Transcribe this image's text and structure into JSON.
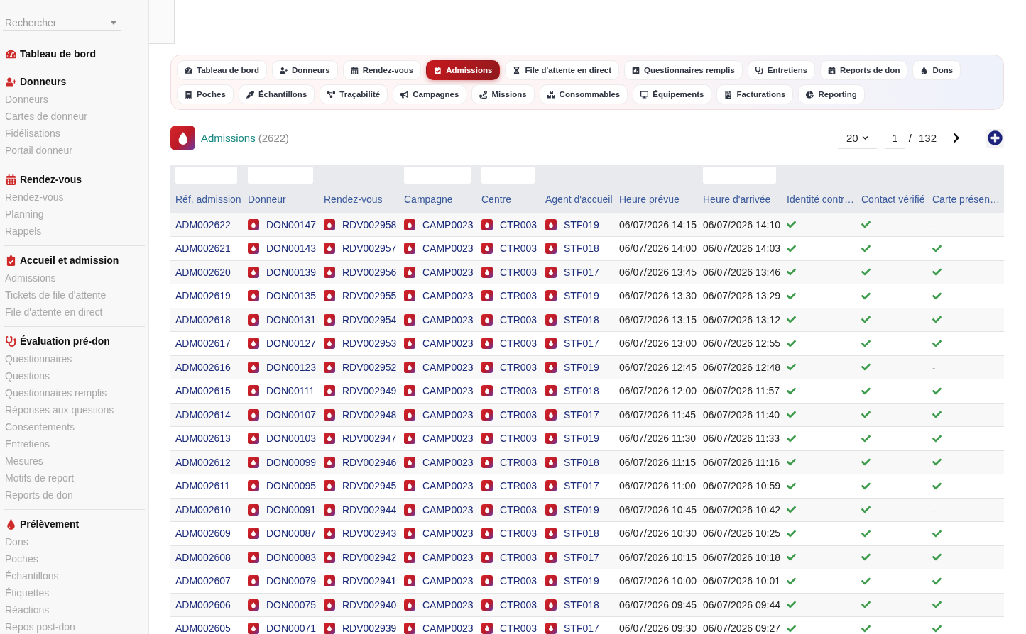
{
  "sidebar": {
    "search": {
      "placeholder": "Rechercher"
    },
    "sections": [
      {
        "title": "Tableau de bord"
      },
      {
        "title": "Donneurs",
        "items": [
          "Donneurs",
          "Cartes de donneur",
          "Fidélisations",
          "Portail donneur"
        ]
      },
      {
        "title": "Rendez-vous",
        "items": [
          "Rendez-vous",
          "Planning",
          "Rappels"
        ]
      },
      {
        "title": "Accueil et admission",
        "items": [
          "Admissions",
          "Tickets de file d'attente",
          "File d'attente en direct"
        ]
      },
      {
        "title": "Évaluation pré-don",
        "items": [
          "Questionnaires",
          "Questions",
          "Questionnaires remplis",
          "Réponses aux questions",
          "Consentements",
          "Entretiens",
          "Mesures",
          "Motifs de report",
          "Reports de don"
        ]
      },
      {
        "title": "Prélèvement",
        "items": [
          "Dons",
          "Poches",
          "Échantillons",
          "Étiquettes",
          "Réactions",
          "Repos post-don"
        ]
      }
    ]
  },
  "nav_tab_rows": [
    [
      {
        "label": "Tableau de bord",
        "selected": false
      },
      {
        "label": "Donneurs",
        "selected": false
      },
      {
        "label": "Rendez-vous",
        "selected": false
      },
      {
        "label": "Admissions",
        "selected": true
      },
      {
        "label": "File d'attente en direct",
        "selected": false
      },
      {
        "label": "Questionnaires remplis",
        "selected": false
      },
      {
        "label": "Entretiens",
        "selected": false
      },
      {
        "label": "Reports de don",
        "selected": false
      },
      {
        "label": "Dons",
        "selected": false
      }
    ],
    [
      {
        "label": "Poches",
        "selected": false
      },
      {
        "label": "Échantillons",
        "selected": false
      },
      {
        "label": "Traçabilité",
        "selected": false
      },
      {
        "label": "Campagnes",
        "selected": false
      },
      {
        "label": "Missions",
        "selected": false
      },
      {
        "label": "Consommables",
        "selected": false
      },
      {
        "label": "Équipements",
        "selected": false
      },
      {
        "label": "Facturations",
        "selected": false
      },
      {
        "label": "Reporting",
        "selected": false
      }
    ]
  ],
  "list_header": {
    "title": "Admissions",
    "count": "(2622)",
    "page_size": "20",
    "page": "1",
    "page_separator": "/",
    "page_count": "132"
  },
  "table": {
    "columns": [
      {
        "label": "Réf. admission",
        "filter": true
      },
      {
        "label": "Donneur",
        "filter": true
      },
      {
        "label": "Rendez-vous",
        "filter": false
      },
      {
        "label": "Campagne",
        "filter": true
      },
      {
        "label": "Centre",
        "filter": true
      },
      {
        "label": "Agent d'accueil",
        "filter": false
      },
      {
        "label": "Heure prévue",
        "filter": false
      },
      {
        "label": "Heure d'arrivée",
        "filter": true
      },
      {
        "label": "Identité contr…",
        "filter": false
      },
      {
        "label": "Contact vérifié",
        "filter": false
      },
      {
        "label": "Carte présen…",
        "filter": false
      }
    ],
    "rows": [
      {
        "ref": "ADM002622",
        "donor": "DON00147",
        "appointment": "RDV002958",
        "campaign": "CAMP0023",
        "center": "CTR003",
        "agent": "STF019",
        "scheduled_time": "06/07/2026 14:15",
        "arrival_time": "06/07/2026 14:10",
        "identity_checked": true,
        "contact_verified": true,
        "card_presented": false,
        "card_presented_text": "-"
      },
      {
        "ref": "ADM002621",
        "donor": "DON00143",
        "appointment": "RDV002957",
        "campaign": "CAMP0023",
        "center": "CTR003",
        "agent": "STF018",
        "scheduled_time": "06/07/2026 14:00",
        "arrival_time": "06/07/2026 14:03",
        "identity_checked": true,
        "contact_verified": true,
        "card_presented": true
      },
      {
        "ref": "ADM002620",
        "donor": "DON00139",
        "appointment": "RDV002956",
        "campaign": "CAMP0023",
        "center": "CTR003",
        "agent": "STF017",
        "scheduled_time": "06/07/2026 13:45",
        "arrival_time": "06/07/2026 13:46",
        "identity_checked": true,
        "contact_verified": true,
        "card_presented": true
      },
      {
        "ref": "ADM002619",
        "donor": "DON00135",
        "appointment": "RDV002955",
        "campaign": "CAMP0023",
        "center": "CTR003",
        "agent": "STF019",
        "scheduled_time": "06/07/2026 13:30",
        "arrival_time": "06/07/2026 13:29",
        "identity_checked": true,
        "contact_verified": true,
        "card_presented": true
      },
      {
        "ref": "ADM002618",
        "donor": "DON00131",
        "appointment": "RDV002954",
        "campaign": "CAMP0023",
        "center": "CTR003",
        "agent": "STF018",
        "scheduled_time": "06/07/2026 13:15",
        "arrival_time": "06/07/2026 13:12",
        "identity_checked": true,
        "contact_verified": true,
        "card_presented": true
      },
      {
        "ref": "ADM002617",
        "donor": "DON00127",
        "appointment": "RDV002953",
        "campaign": "CAMP0023",
        "center": "CTR003",
        "agent": "STF017",
        "scheduled_time": "06/07/2026 13:00",
        "arrival_time": "06/07/2026 12:55",
        "identity_checked": true,
        "contact_verified": true,
        "card_presented": true
      },
      {
        "ref": "ADM002616",
        "donor": "DON00123",
        "appointment": "RDV002952",
        "campaign": "CAMP0023",
        "center": "CTR003",
        "agent": "STF019",
        "scheduled_time": "06/07/2026 12:45",
        "arrival_time": "06/07/2026 12:48",
        "identity_checked": true,
        "contact_verified": true,
        "card_presented": false,
        "card_presented_text": "-"
      },
      {
        "ref": "ADM002615",
        "donor": "DON00111",
        "appointment": "RDV002949",
        "campaign": "CAMP0023",
        "center": "CTR003",
        "agent": "STF018",
        "scheduled_time": "06/07/2026 12:00",
        "arrival_time": "06/07/2026 11:57",
        "identity_checked": true,
        "contact_verified": true,
        "card_presented": true
      },
      {
        "ref": "ADM002614",
        "donor": "DON00107",
        "appointment": "RDV002948",
        "campaign": "CAMP0023",
        "center": "CTR003",
        "agent": "STF017",
        "scheduled_time": "06/07/2026 11:45",
        "arrival_time": "06/07/2026 11:40",
        "identity_checked": true,
        "contact_verified": true,
        "card_presented": true
      },
      {
        "ref": "ADM002613",
        "donor": "DON00103",
        "appointment": "RDV002947",
        "campaign": "CAMP0023",
        "center": "CTR003",
        "agent": "STF019",
        "scheduled_time": "06/07/2026 11:30",
        "arrival_time": "06/07/2026 11:33",
        "identity_checked": true,
        "contact_verified": true,
        "card_presented": true
      },
      {
        "ref": "ADM002612",
        "donor": "DON00099",
        "appointment": "RDV002946",
        "campaign": "CAMP0023",
        "center": "CTR003",
        "agent": "STF018",
        "scheduled_time": "06/07/2026 11:15",
        "arrival_time": "06/07/2026 11:16",
        "identity_checked": true,
        "contact_verified": true,
        "card_presented": true
      },
      {
        "ref": "ADM002611",
        "donor": "DON00095",
        "appointment": "RDV002945",
        "campaign": "CAMP0023",
        "center": "CTR003",
        "agent": "STF017",
        "scheduled_time": "06/07/2026 11:00",
        "arrival_time": "06/07/2026 10:59",
        "identity_checked": true,
        "contact_verified": true,
        "card_presented": true
      },
      {
        "ref": "ADM002610",
        "donor": "DON00091",
        "appointment": "RDV002944",
        "campaign": "CAMP0023",
        "center": "CTR003",
        "agent": "STF019",
        "scheduled_time": "06/07/2026 10:45",
        "arrival_time": "06/07/2026 10:42",
        "identity_checked": true,
        "contact_verified": true,
        "card_presented": false,
        "card_presented_text": "-"
      },
      {
        "ref": "ADM002609",
        "donor": "DON00087",
        "appointment": "RDV002943",
        "campaign": "CAMP0023",
        "center": "CTR003",
        "agent": "STF018",
        "scheduled_time": "06/07/2026 10:30",
        "arrival_time": "06/07/2026 10:25",
        "identity_checked": true,
        "contact_verified": true,
        "card_presented": true
      },
      {
        "ref": "ADM002608",
        "donor": "DON00083",
        "appointment": "RDV002942",
        "campaign": "CAMP0023",
        "center": "CTR003",
        "agent": "STF017",
        "scheduled_time": "06/07/2026 10:15",
        "arrival_time": "06/07/2026 10:18",
        "identity_checked": true,
        "contact_verified": true,
        "card_presented": true
      },
      {
        "ref": "ADM002607",
        "donor": "DON00079",
        "appointment": "RDV002941",
        "campaign": "CAMP0023",
        "center": "CTR003",
        "agent": "STF019",
        "scheduled_time": "06/07/2026 10:00",
        "arrival_time": "06/07/2026 10:01",
        "identity_checked": true,
        "contact_verified": true,
        "card_presented": true
      },
      {
        "ref": "ADM002606",
        "donor": "DON00075",
        "appointment": "RDV002940",
        "campaign": "CAMP0023",
        "center": "CTR003",
        "agent": "STF018",
        "scheduled_time": "06/07/2026 09:45",
        "arrival_time": "06/07/2026 09:44",
        "identity_checked": true,
        "contact_verified": true,
        "card_presented": true
      },
      {
        "ref": "ADM002605",
        "donor": "DON00071",
        "appointment": "RDV002939",
        "campaign": "CAMP0023",
        "center": "CTR003",
        "agent": "STF017",
        "scheduled_time": "06/07/2026 09:30",
        "arrival_time": "06/07/2026 09:27",
        "identity_checked": true,
        "contact_verified": true,
        "card_presented": true
      }
    ]
  }
}
